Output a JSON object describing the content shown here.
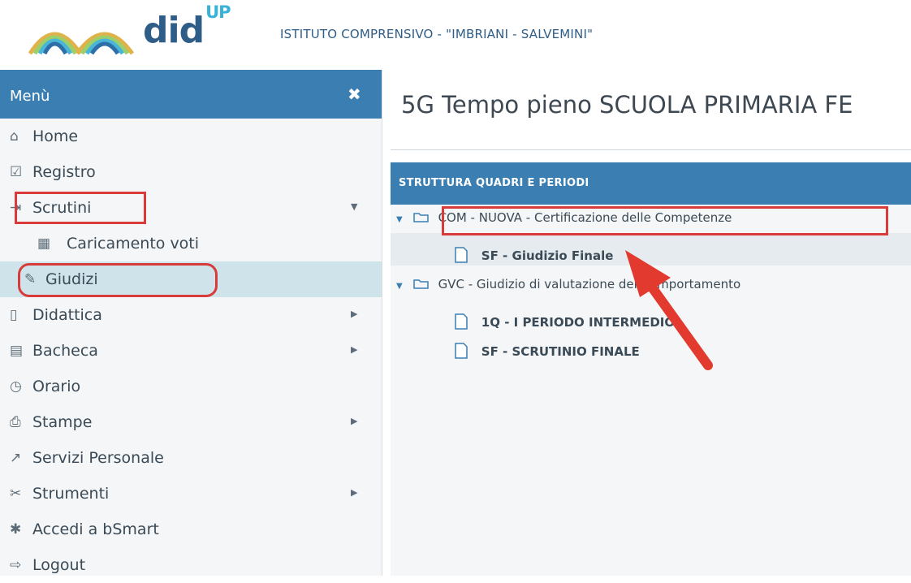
{
  "header": {
    "brand": "did",
    "brand_sup": "UP",
    "school": "ISTITUTO COMPRENSIVO - \"IMBRIANI - SALVEMINI\""
  },
  "sidebar": {
    "title": "Menù",
    "close_icon": "close-icon",
    "items": [
      {
        "label": "Home",
        "icon": "home-icon"
      },
      {
        "label": "Registro",
        "icon": "calendar-icon"
      },
      {
        "label": "Scrutini",
        "icon": "export-doc-icon",
        "expanded": true
      },
      {
        "label": "Caricamento voti",
        "icon": "grid-icon",
        "sub": true
      },
      {
        "label": "Giudizi",
        "icon": "edit-icon",
        "sub": true,
        "active": true
      },
      {
        "label": "Didattica",
        "icon": "book-icon",
        "submenu": true
      },
      {
        "label": "Bacheca",
        "icon": "board-icon",
        "submenu": true
      },
      {
        "label": "Orario",
        "icon": "clock-icon"
      },
      {
        "label": "Stampe",
        "icon": "printer-icon",
        "submenu": true
      },
      {
        "label": "Servizi Personale",
        "icon": "share-icon"
      },
      {
        "label": "Strumenti",
        "icon": "tools-icon",
        "submenu": true
      },
      {
        "label": "Accedi a bSmart",
        "icon": "bsmart-icon"
      },
      {
        "label": "Logout",
        "icon": "logout-icon"
      }
    ]
  },
  "main": {
    "page_title": "5G Tempo pieno SCUOLA PRIMARIA FE",
    "panel_title": "STRUTTURA QUADRI E PERIODI",
    "tree": [
      {
        "label": "COM - NUOVA - Certificazione delle Competenze",
        "children": [
          "SF - Giudizio Finale"
        ]
      },
      {
        "label": "GVC - Giudizio di valutazione del Comportamento",
        "children": [
          "1Q - I PERIODO INTERMEDIO",
          "SF - SCRUTINIO FINALE"
        ]
      }
    ]
  },
  "colors": {
    "accent_blue": "#3b7fb2",
    "highlight_red": "#d93b3b",
    "active_bg": "#cfe4ea"
  }
}
